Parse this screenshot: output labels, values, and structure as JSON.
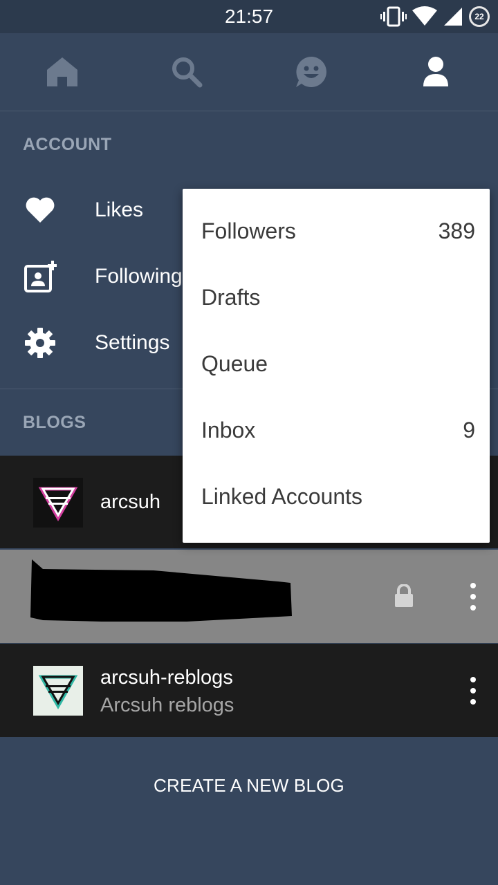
{
  "status_bar": {
    "time": "21:57",
    "battery_level": "22"
  },
  "tabs": [
    {
      "name": "home",
      "icon": "home-icon"
    },
    {
      "name": "search",
      "icon": "search-icon"
    },
    {
      "name": "activity",
      "icon": "smiley-chat-icon"
    },
    {
      "name": "account",
      "icon": "person-icon",
      "active": true
    }
  ],
  "account_section": {
    "label": "ACCOUNT",
    "items": [
      {
        "label": "Likes",
        "icon": "heart-icon"
      },
      {
        "label": "Following",
        "icon": "add-contact-icon"
      },
      {
        "label": "Settings",
        "icon": "gear-icon"
      }
    ]
  },
  "blogs_section": {
    "label": "BLOGS",
    "blogs": [
      {
        "name": "arcsuh",
        "subtitle": ""
      },
      {
        "name": "",
        "subtitle": "",
        "private": true
      },
      {
        "name": "arcsuh-reblogs",
        "subtitle": "Arcsuh reblogs"
      }
    ],
    "create_label": "CREATE A NEW BLOG"
  },
  "popup_menu": {
    "items": [
      {
        "label": "Followers",
        "count": "389"
      },
      {
        "label": "Drafts",
        "count": ""
      },
      {
        "label": "Queue",
        "count": ""
      },
      {
        "label": "Inbox",
        "count": "9"
      },
      {
        "label": "Linked Accounts",
        "count": ""
      }
    ]
  },
  "colors": {
    "background": "#36465d",
    "status_bar": "#2c3a4d",
    "blog_row_dark": "#1c1c1c",
    "blog_row_selected": "#868686",
    "popup_bg": "#ffffff",
    "muted_label": "#9aa6b6"
  }
}
